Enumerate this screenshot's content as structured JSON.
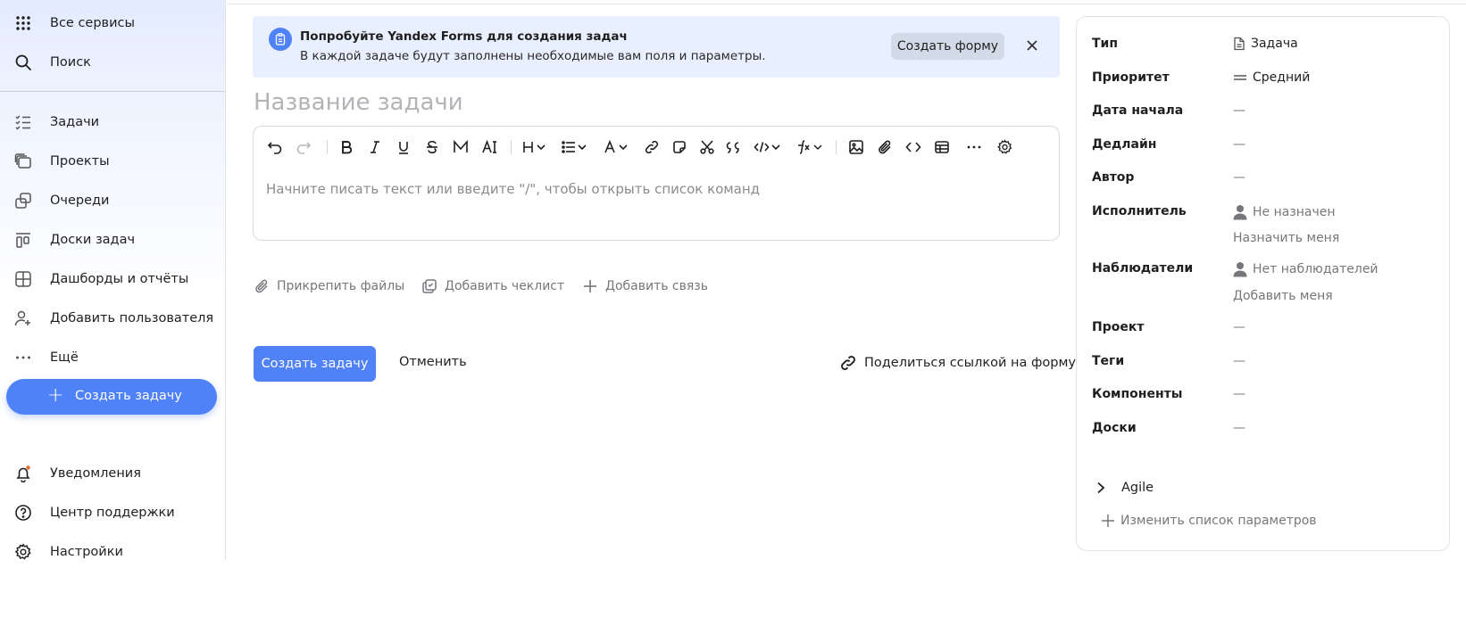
{
  "sidebar": {
    "top_items": [
      {
        "label": "Все сервисы",
        "icon": "grid-icon"
      },
      {
        "label": "Поиск",
        "icon": "search-icon"
      }
    ],
    "items": [
      {
        "label": "Задачи",
        "icon": "tasks-icon"
      },
      {
        "label": "Проекты",
        "icon": "projects-icon"
      },
      {
        "label": "Очереди",
        "icon": "queues-icon"
      },
      {
        "label": "Доски задач",
        "icon": "boards-icon"
      },
      {
        "label": "Дашборды и отчёты",
        "icon": "dashboards-icon"
      },
      {
        "label": "Добавить пользователя",
        "icon": "add-user-icon"
      },
      {
        "label": "Ещё",
        "icon": "more-icon"
      }
    ],
    "create_button": "Создать задачу",
    "bottom_items": [
      {
        "label": "Уведомления",
        "icon": "bell-icon"
      },
      {
        "label": "Центр поддержки",
        "icon": "help-icon"
      },
      {
        "label": "Настройки",
        "icon": "gear-icon"
      }
    ]
  },
  "banner": {
    "title": "Попробуйте Yandex Forms для создания задач",
    "text": "В каждой задаче будут заполнены необходимые вам поля и параметры.",
    "button": "Создать форму"
  },
  "task": {
    "title_placeholder": "Название задачи",
    "editor_placeholder": "Начните писать текст или введите \"/\", чтобы открыть список команд"
  },
  "actions": {
    "attach": "Прикрепить файлы",
    "checklist": "Добавить чеклист",
    "link": "Добавить связь"
  },
  "footer": {
    "create": "Создать задачу",
    "cancel": "Отменить",
    "share": "Поделиться ссылкой на форму"
  },
  "panel": {
    "type": {
      "label": "Тип",
      "value": "Задача"
    },
    "priority": {
      "label": "Приоритет",
      "value": "Средний"
    },
    "start_date": {
      "label": "Дата начала",
      "value": "—"
    },
    "deadline": {
      "label": "Дедлайн",
      "value": "—"
    },
    "author": {
      "label": "Автор",
      "value": "—"
    },
    "assignee": {
      "label": "Исполнитель",
      "value": "Не назначен",
      "action": "Назначить меня"
    },
    "watchers": {
      "label": "Наблюдатели",
      "value": "Нет наблюдателей",
      "action": "Добавить меня"
    },
    "project": {
      "label": "Проект",
      "value": "—"
    },
    "tags": {
      "label": "Теги",
      "value": "—"
    },
    "components": {
      "label": "Компоненты",
      "value": "—"
    },
    "boards": {
      "label": "Доски",
      "value": "—"
    },
    "agile": "Agile",
    "edit_params": "Изменить список параметров"
  },
  "colors": {
    "accent": "#4f81f7",
    "banner_bg": "#e8efff",
    "sidebar_bg": "#e3ebff"
  }
}
